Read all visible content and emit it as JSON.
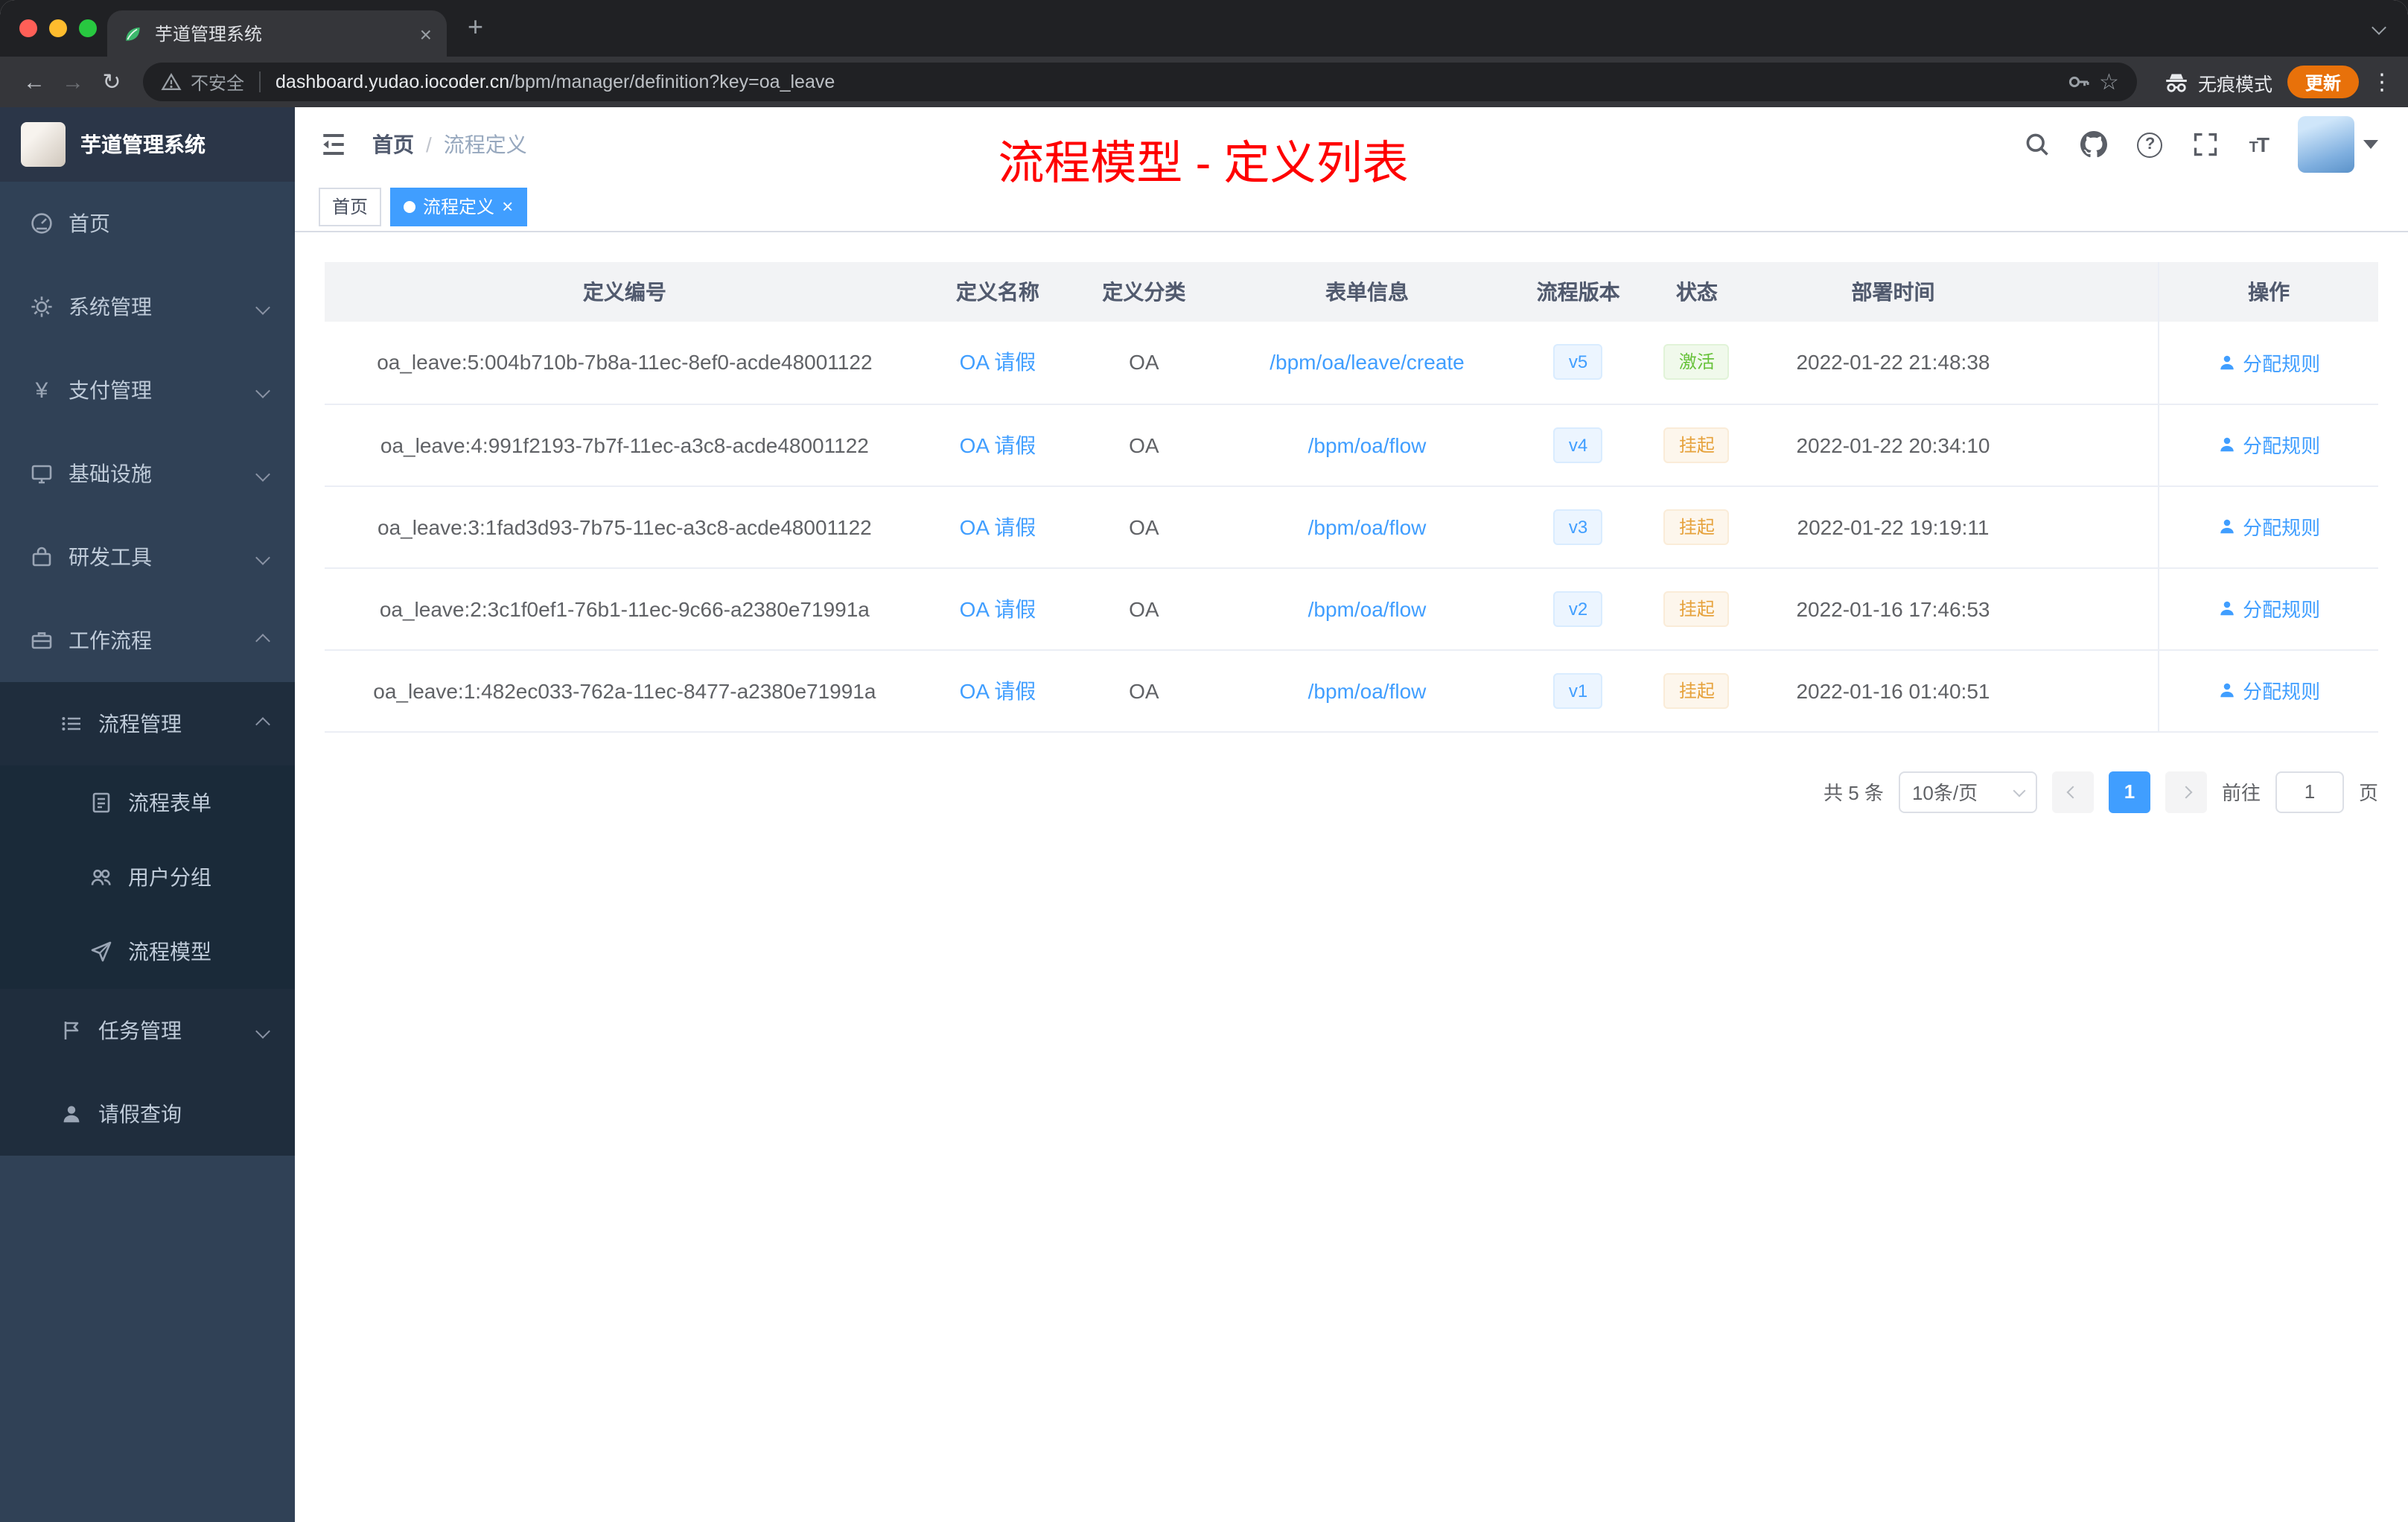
{
  "browser": {
    "tab": {
      "title": "芋道管理系统"
    },
    "address": {
      "security_label": "不安全",
      "host": "dashboard.yudao.iocoder.cn",
      "path": "/bpm/manager/definition?key=oa_leave"
    },
    "incognito_label": "无痕模式",
    "update_label": "更新"
  },
  "sidebar": {
    "app_title": "芋道管理系统",
    "items": [
      {
        "label": "首页"
      },
      {
        "label": "系统管理"
      },
      {
        "label": "支付管理"
      },
      {
        "label": "基础设施"
      },
      {
        "label": "研发工具"
      },
      {
        "label": "工作流程"
      }
    ],
    "workflow": {
      "process_management": {
        "label": "流程管理"
      },
      "process_children": [
        {
          "label": "流程表单"
        },
        {
          "label": "用户分组"
        },
        {
          "label": "流程模型"
        }
      ],
      "task_management": {
        "label": "任务管理"
      },
      "leave_query": {
        "label": "请假查询"
      }
    }
  },
  "header": {
    "breadcrumb": {
      "home": "首页",
      "separator": "/",
      "current": "流程定义"
    },
    "annotation": "流程模型 - 定义列表"
  },
  "tags_view": {
    "tags": [
      {
        "label": "首页"
      },
      {
        "label": "流程定义"
      }
    ]
  },
  "table": {
    "columns": [
      "定义编号",
      "定义名称",
      "定义分类",
      "表单信息",
      "流程版本",
      "状态",
      "部署时间",
      "操作"
    ],
    "rows": [
      {
        "id": "oa_leave:5:004b710b-7b8a-11ec-8ef0-acde48001122",
        "name": "OA 请假",
        "category": "OA",
        "form": "/bpm/oa/leave/create",
        "version": "v5",
        "status": "激活",
        "status_type": "active",
        "deploy_time": "2022-01-22 21:48:38",
        "action": "分配规则"
      },
      {
        "id": "oa_leave:4:991f2193-7b7f-11ec-a3c8-acde48001122",
        "name": "OA 请假",
        "category": "OA",
        "form": "/bpm/oa/flow",
        "version": "v4",
        "status": "挂起",
        "status_type": "suspended",
        "deploy_time": "2022-01-22 20:34:10",
        "action": "分配规则"
      },
      {
        "id": "oa_leave:3:1fad3d93-7b75-11ec-a3c8-acde48001122",
        "name": "OA 请假",
        "category": "OA",
        "form": "/bpm/oa/flow",
        "version": "v3",
        "status": "挂起",
        "status_type": "suspended",
        "deploy_time": "2022-01-22 19:19:11",
        "action": "分配规则"
      },
      {
        "id": "oa_leave:2:3c1f0ef1-76b1-11ec-9c66-a2380e71991a",
        "name": "OA 请假",
        "category": "OA",
        "form": "/bpm/oa/flow",
        "version": "v2",
        "status": "挂起",
        "status_type": "suspended",
        "deploy_time": "2022-01-16 17:46:53",
        "action": "分配规则"
      },
      {
        "id": "oa_leave:1:482ec033-762a-11ec-8477-a2380e71991a",
        "name": "OA 请假",
        "category": "OA",
        "form": "/bpm/oa/flow",
        "version": "v1",
        "status": "挂起",
        "status_type": "suspended",
        "deploy_time": "2022-01-16 01:40:51",
        "action": "分配规则"
      }
    ]
  },
  "pagination": {
    "total": "共 5 条",
    "page_size": "10条/页",
    "current_page": "1",
    "goto_label": "前往",
    "goto_value": "1",
    "page_unit": "页"
  },
  "colors": {
    "accent": "#409eff",
    "annotation_red": "#ff0000",
    "status_active_green": "#67c23a",
    "status_suspended_orange": "#e6a23c",
    "sidebar_bg": "#304156",
    "submenu_bg": "#1f2d3d"
  }
}
